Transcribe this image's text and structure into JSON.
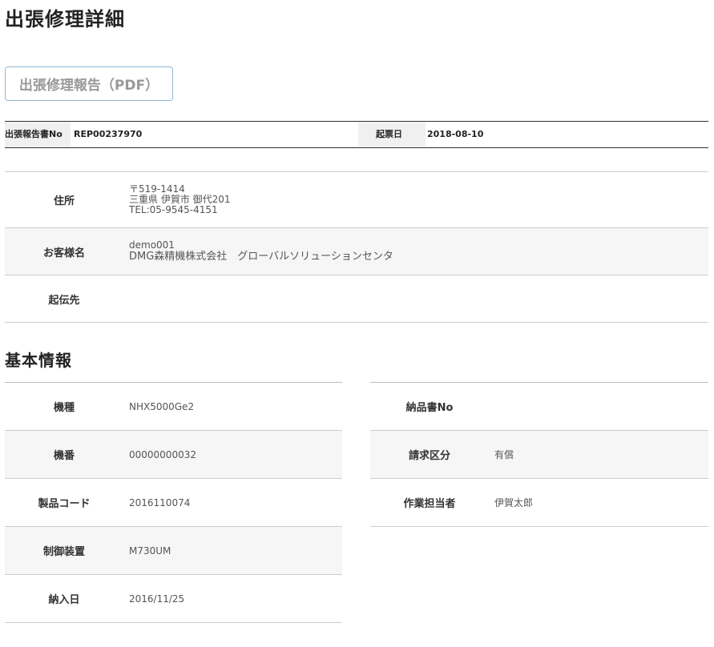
{
  "page": {
    "title": "出張修理詳細"
  },
  "toolbar": {
    "pdf_button_label": "出張修理報告（PDF）"
  },
  "report_header": {
    "report_no_label": "出張報告書No",
    "report_no": "REP00237970",
    "issue_date_label": "起票日",
    "issue_date": "2018-08-10"
  },
  "customer": {
    "address_label": "住所",
    "postal_code": "〒519-1414",
    "address": "三重県 伊賀市 御代201",
    "tel": "TEL:05-9545-4151",
    "customer_name_label": "お客様名",
    "customer_id": "demo001",
    "customer_name": "DMG森精機株式会社　グローバルソリューションセンタ",
    "origin_label": "起伝先",
    "origin": ""
  },
  "basic_info": {
    "title": "基本情報",
    "left": [
      {
        "label": "機種",
        "value": "NHX5000Ge2"
      },
      {
        "label": "機番",
        "value": "00000000032"
      },
      {
        "label": "製品コード",
        "value": "2016110074"
      },
      {
        "label": "制御装置",
        "value": "M730UM"
      },
      {
        "label": "納入日",
        "value": "2016/11/25"
      }
    ],
    "right": [
      {
        "label": "納品書No",
        "value": ""
      },
      {
        "label": "請求区分",
        "value": "有償"
      },
      {
        "label": "作業担当者",
        "value": "伊賀太郎"
      }
    ]
  }
}
